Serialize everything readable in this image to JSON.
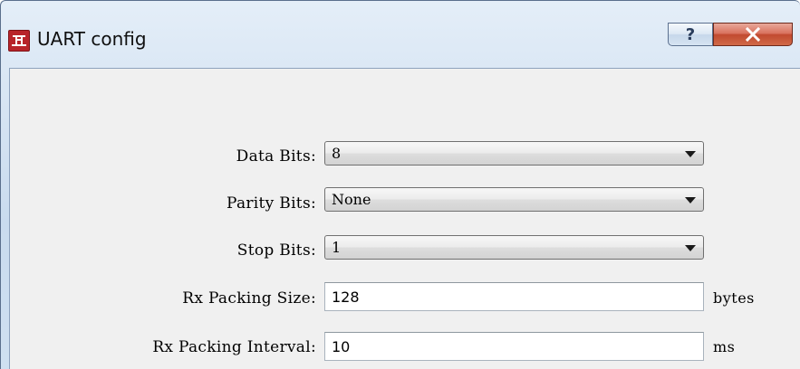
{
  "window": {
    "title": "UART config",
    "help_label": "?",
    "close_label": "close"
  },
  "icons": {
    "app": "app-logo-icon",
    "help": "question-mark-icon",
    "close": "close-x-icon",
    "dropdown": "chevron-down-icon"
  },
  "colors": {
    "app_icon": "#b8242a",
    "close_button": "#c14a30",
    "client_bg": "#f0f0f0"
  },
  "form": {
    "data_bits": {
      "label": "Data Bits:",
      "value": "8"
    },
    "parity_bits": {
      "label": "Parity Bits:",
      "value": "None"
    },
    "stop_bits": {
      "label": "Stop Bits:",
      "value": "1"
    },
    "rx_packing_size": {
      "label": "Rx Packing Size:",
      "value": "128",
      "unit": "bytes"
    },
    "rx_packing_interval": {
      "label": "Rx Packing Interval:",
      "value": "10",
      "unit": "ms"
    }
  }
}
